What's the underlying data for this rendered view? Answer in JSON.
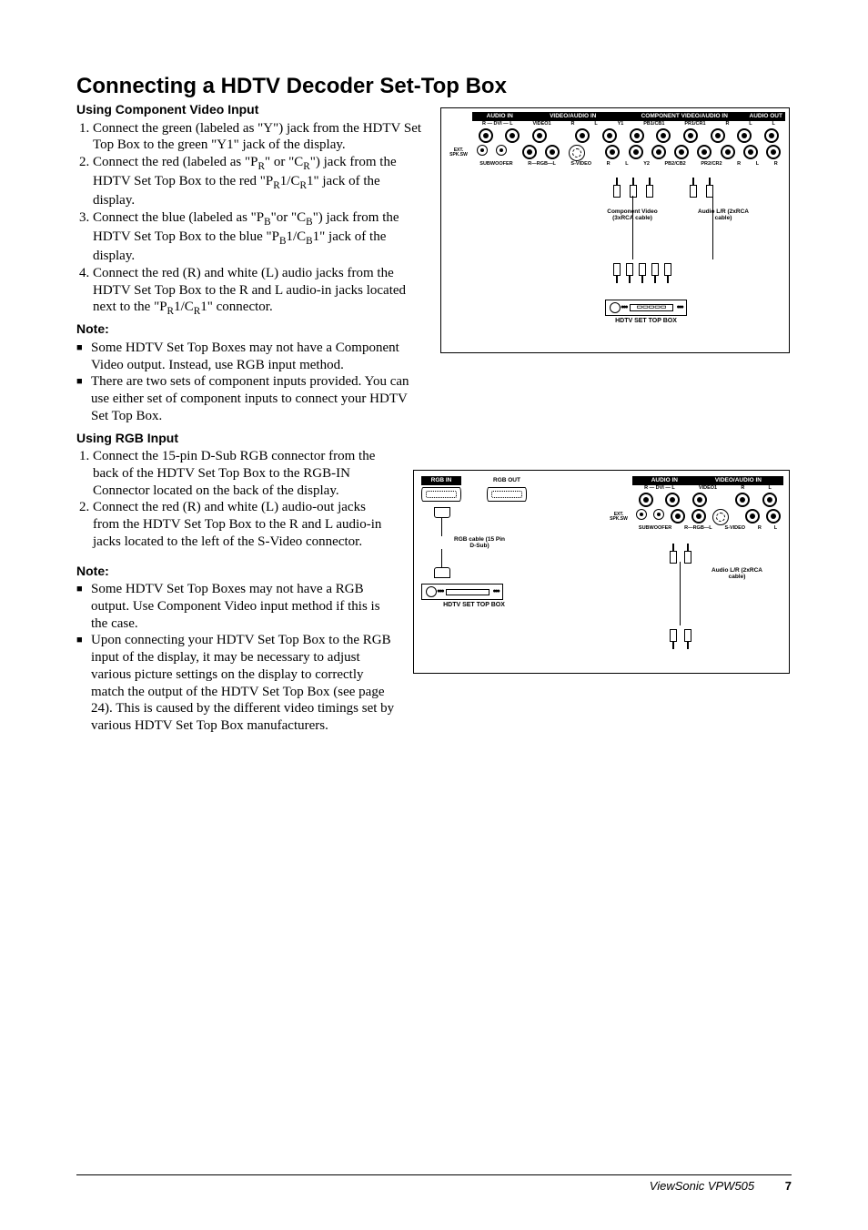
{
  "title": "Connecting a HDTV Decoder Set-Top Box",
  "section1": {
    "heading": "Using Component Video Input",
    "steps": [
      "Connect the green (labeled as \"Y\") jack from the HDTV Set Top Box  to the green \"Y1\" jack of the display.",
      "Connect the red (labeled as \"P_R\" or \"C_R\") jack from the HDTV Set Top Box to the red \"P_R1/C_R1\" jack of the display.",
      "Connect the blue (labeled as \"P_B\"or \"C_B\") jack from the HDTV Set Top Box to the blue  \"P_B1/C_B1\" jack of the display.",
      "Connect the red (R) and white (L) audio jacks from the HDTV Set Top Box to the R and L audio-in jacks located next to the \"P_R1/C_R1\" connector."
    ],
    "note_head": "Note:",
    "notes": [
      "Some HDTV Set Top Boxes may not have a Component Video output.  Instead, use RGB input method.",
      "There are two sets of component inputs provided.  You can use either set of component inputs to connect your HDTV Set Top Box."
    ]
  },
  "section2": {
    "heading": "Using RGB Input",
    "steps": [
      "Connect the 15-pin D-Sub RGB connector from the back of the HDTV Set Top Box to the RGB-IN Connector located on the back of the display.",
      "Connect the red (R) and white (L) audio-out jacks from the HDTV Set Top Box to the R and L audio-in jacks located to the left of the S-Video connector."
    ],
    "note_head": "Note:",
    "notes": [
      "Some HDTV Set Top Boxes may not have a RGB output.  Use Component Video input method if this is the case.",
      "Upon connecting your HDTV Set Top Box to the RGB input of the display, it may be necessary to adjust various picture settings on the display to correctly match the output of the HDTV Set Top Box (see page 24).  This is caused by the different video timings set by various HDTV Set Top Box manufacturers."
    ]
  },
  "diagram1": {
    "headers": [
      "AUDIO IN",
      "VIDEO/AUDIO IN",
      "COMPONENT VIDEO/AUDIO IN",
      "AUDIO OUT"
    ],
    "top_labels": [
      "R — DVI — L",
      "VIDEO1",
      "R",
      "L",
      "Y1",
      "PB1/CB1",
      "PR1/CR1",
      "R",
      "L",
      "L"
    ],
    "bot_labels": [
      "SUBWOOFER",
      "R—RGB—L",
      "S-VIDEO",
      "R",
      "L",
      "Y2",
      "PB2/CB2",
      "PR2/CR2",
      "R",
      "L",
      "R"
    ],
    "side": "EXT. SPK.SW",
    "cable1": "Component Video (3xRCA cable)",
    "cable2": "Audio L/R (2xRCA cable)",
    "box": "HDTV SET TOP BOX"
  },
  "diagram2": {
    "rgb_in": "RGB IN",
    "rgb_out": "RGB  OUT",
    "rgb_cable": "RGB cable (15 Pin D-Sub)",
    "box": "HDTV SET TOP BOX",
    "headers": [
      "AUDIO IN",
      "VIDEO/AUDIO IN"
    ],
    "top_labels": [
      "R — DVI — L",
      "VIDEO1",
      "R",
      "L"
    ],
    "bot_labels": [
      "SUBWOOFER",
      "R—RGB—L",
      "S-VIDEO",
      "R",
      "L"
    ],
    "side": "EXT. SPK.SW",
    "cable": "Audio L/R (2xRCA cable)"
  },
  "footer": {
    "product": "ViewSonic  VPW505",
    "page": "7"
  }
}
